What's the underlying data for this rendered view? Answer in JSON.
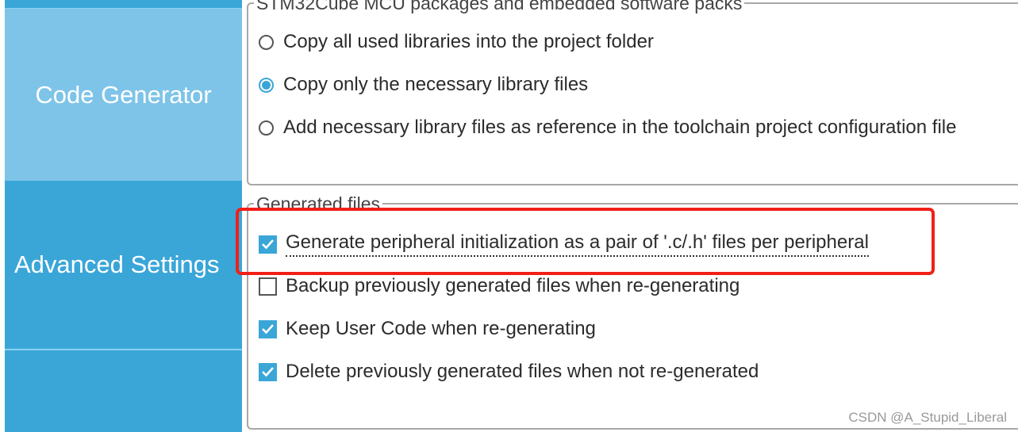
{
  "sidebar": {
    "items": [
      {
        "label": "Code Generator",
        "selected": false
      },
      {
        "label": "Advanced Settings",
        "selected": true
      },
      {
        "label": ""
      }
    ]
  },
  "packages_group": {
    "legend": "STM32Cube MCU packages and embedded software packs",
    "options": [
      {
        "label": "Copy all used libraries into the project folder",
        "selected": false
      },
      {
        "label": "Copy only the necessary library files",
        "selected": true
      },
      {
        "label": "Add necessary library files as reference in the toolchain project configuration file",
        "selected": false
      }
    ]
  },
  "generated_group": {
    "legend": "Generated files",
    "options": [
      {
        "label": "Generate peripheral initialization as a pair of '.c/.h' files per peripheral",
        "checked": true
      },
      {
        "label": "Backup previously generated files when re-generating",
        "checked": false
      },
      {
        "label": "Keep User Code when re-generating",
        "checked": true
      },
      {
        "label": "Delete previously generated files when not re-generated",
        "checked": true
      }
    ]
  },
  "watermark": "CSDN @A_Stupid_Liberal",
  "colors": {
    "accent": "#3aa6d8",
    "sidebar_light": "#7dc4e8",
    "highlight": "#f02018"
  }
}
